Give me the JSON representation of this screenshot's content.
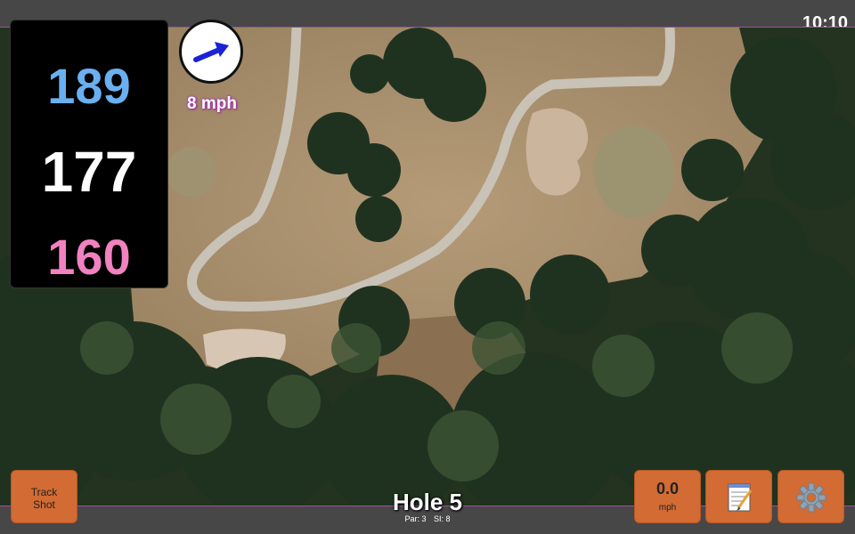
{
  "status": {
    "time": "10:10"
  },
  "yardage": {
    "back": "189",
    "center": "177",
    "front": "160"
  },
  "wind": {
    "speed": "8 mph",
    "icon": "wind-arrow-icon"
  },
  "buttons": {
    "track_shot_line1": "Track",
    "track_shot_line2": "Shot",
    "speed_value": "0.0",
    "speed_unit": "mph",
    "notes_icon": "notepad-icon",
    "settings_icon": "gear-icon"
  },
  "hole": {
    "title": "Hole 5",
    "par": "Par: 3",
    "si": "SI: 8"
  },
  "colors": {
    "button": "#d26b34",
    "back_yardage": "#6ab0f0",
    "front_yardage": "#f082c0",
    "accent": "#a64aa6"
  }
}
